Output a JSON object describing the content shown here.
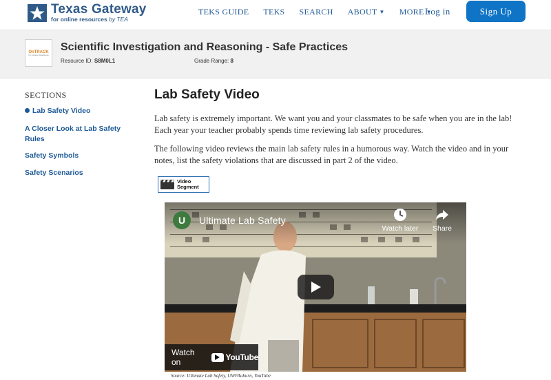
{
  "header": {
    "logo_title": "Texas Gateway",
    "logo_sub": "for online resources",
    "logo_by": "by TEA",
    "nav": [
      {
        "label": "TEKS GUIDE",
        "dropdown": false
      },
      {
        "label": "TEKS",
        "dropdown": false
      },
      {
        "label": "SEARCH",
        "dropdown": false
      },
      {
        "label": "ABOUT",
        "dropdown": true
      },
      {
        "label": "MORE",
        "dropdown": true
      }
    ],
    "login_label": "Log in",
    "signup_label": "Sign Up"
  },
  "resource": {
    "thumb_brand": "OnTRACK",
    "thumb_sub": "for College Readiness",
    "title": "Scientific Investigation and Reasoning - Safe Practices",
    "id_label": "Resource ID:",
    "id_value": "S8M0L1",
    "grade_label": "Grade Range:",
    "grade_value": "8"
  },
  "sidebar": {
    "heading": "SECTIONS",
    "items": [
      {
        "label": "Lab Safety Video",
        "active": true
      },
      {
        "label": "A Closer Look at Lab Safety Rules",
        "active": false
      },
      {
        "label": "Safety Symbols",
        "active": false
      },
      {
        "label": "Safety Scenarios",
        "active": false
      }
    ]
  },
  "main": {
    "title": "Lab Safety Video",
    "paragraph1": "Lab safety is extremely important. We want you and your classmates to be safe when you are in the lab! Each year your teacher probably spends time reviewing lab safety procedures.",
    "paragraph2": "The following video reviews the main lab safety rules in a humorous way. Watch the video and in your notes, list the safety violations that are discussed in part 2 of the video.",
    "badge_line1": "Video",
    "badge_line2": "Segment",
    "video": {
      "channel_initial": "U",
      "title": "Ultimate Lab Safety",
      "watch_later": "Watch later",
      "share": "Share",
      "watch_on": "Watch on",
      "youtube": "YouTube"
    },
    "caption": "Source: Ultimate Lab Safety, UWFAuburn, YouTube"
  },
  "colors": {
    "brand_blue": "#2f5a88",
    "link_blue": "#1f5a96",
    "signup_bg": "#0f74c6",
    "band_bg": "#f1f1f1"
  }
}
